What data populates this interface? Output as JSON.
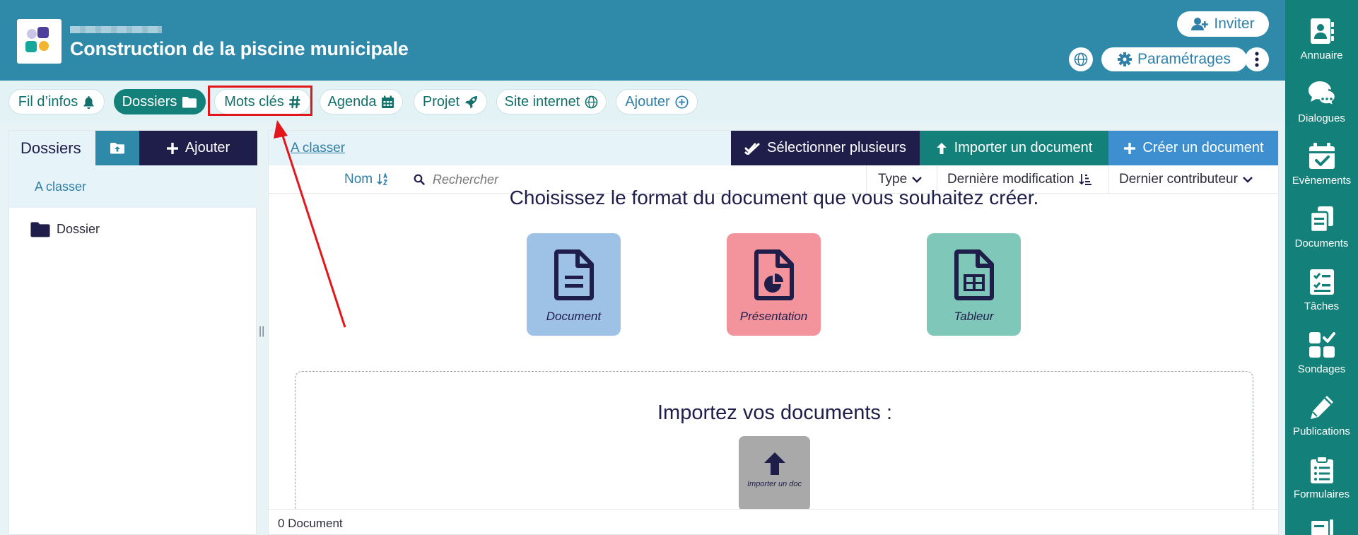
{
  "header": {
    "title": "Construction de la piscine municipale",
    "invite_label": "Inviter",
    "params_label": "Paramétrages"
  },
  "tabs": [
    {
      "label": "Fil d’infos"
    },
    {
      "label": "Dossiers"
    },
    {
      "label": "Mots clés"
    },
    {
      "label": "Agenda"
    },
    {
      "label": "Projet"
    },
    {
      "label": "Site internet"
    },
    {
      "label": "Ajouter"
    }
  ],
  "left_panel": {
    "title": "Dossiers",
    "add_label": "Ajouter",
    "selected_folder": "A classer",
    "folders": [
      "Dossier"
    ]
  },
  "main": {
    "breadcrumb": "A classer",
    "select_label": "Sélectionner plusieurs",
    "import_label": "Importer un document",
    "create_label": "Créer un document",
    "columns": {
      "name": "Nom",
      "search_placeholder": "Rechercher",
      "type": "Type",
      "modified": "Dernière modification",
      "contributor": "Dernier contributeur"
    },
    "choose_text": "Choisissez le format du document que vous souhaitez créer.",
    "formats": [
      {
        "label": "Document"
      },
      {
        "label": "Présentation"
      },
      {
        "label": "Tableur"
      }
    ],
    "import_title": "Importez vos documents :",
    "import_box_label": "Importer un doc",
    "footer": "0 Document"
  },
  "sidebar": {
    "items": [
      {
        "label": "Annuaire",
        "icon": "contact-book-icon"
      },
      {
        "label": "Dialogues",
        "icon": "chat-bubbles-icon"
      },
      {
        "label": "Evènements",
        "icon": "calendar-check-icon"
      },
      {
        "label": "Documents",
        "icon": "documents-icon"
      },
      {
        "label": "Tâches",
        "icon": "checklist-icon"
      },
      {
        "label": "Sondages",
        "icon": "poll-grid-icon"
      },
      {
        "label": "Publications",
        "icon": "pencil-icon"
      },
      {
        "label": "Formulaires",
        "icon": "clipboard-list-icon"
      }
    ]
  },
  "colors": {
    "header_bg": "#2f8aaa",
    "teal": "#13807a",
    "navy": "#1f1d4a",
    "blue": "#3d8fd0",
    "highlight_red": "#e3161b"
  }
}
